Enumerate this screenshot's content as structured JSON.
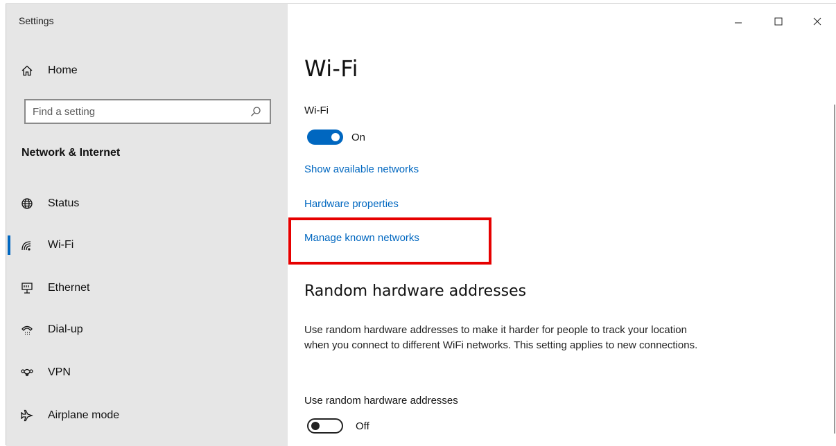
{
  "window": {
    "app_title": "Settings",
    "controls": {
      "minimize_icon": "minimize-icon",
      "maximize_icon": "maximize-icon",
      "close_icon": "close-icon"
    }
  },
  "sidebar": {
    "home_label": "Home",
    "search": {
      "placeholder": "Find a setting",
      "value": ""
    },
    "section_title": "Network & Internet",
    "items": [
      {
        "label": "Status",
        "icon": "globe-icon",
        "active": false
      },
      {
        "label": "Wi-Fi",
        "icon": "wifi-icon",
        "active": true
      },
      {
        "label": "Ethernet",
        "icon": "ethernet-icon",
        "active": false
      },
      {
        "label": "Dial-up",
        "icon": "dialup-icon",
        "active": false
      },
      {
        "label": "VPN",
        "icon": "vpn-icon",
        "active": false
      },
      {
        "label": "Airplane mode",
        "icon": "airplane-icon",
        "active": false
      }
    ]
  },
  "main": {
    "title": "Wi-Fi",
    "wifi": {
      "label": "Wi-Fi",
      "toggle_state": "On",
      "toggle_on": true
    },
    "links": {
      "show_networks": "Show available networks",
      "hardware_properties": "Hardware properties",
      "manage_known": "Manage known networks"
    },
    "random_hw": {
      "heading": "Random hardware addresses",
      "description": "Use random hardware addresses to make it harder for people to track your location when you connect to different WiFi networks. This setting applies to new connections.",
      "toggle_label": "Use random hardware addresses",
      "toggle_state": "Off",
      "toggle_on": false
    }
  },
  "colors": {
    "accent": "#0067c0",
    "highlight": "#e60000",
    "sidebar_bg": "#e6e6e6"
  }
}
